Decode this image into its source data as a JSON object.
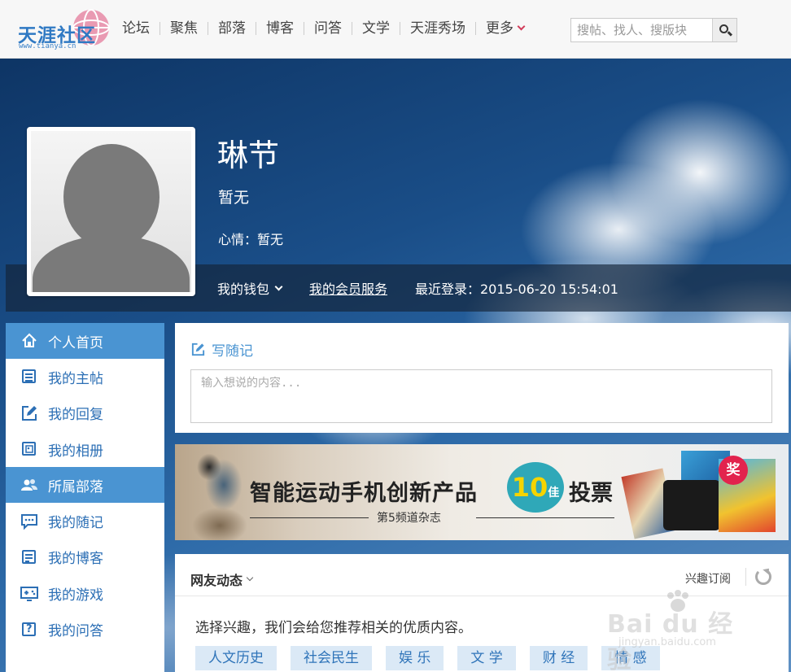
{
  "site": {
    "logo_text": "天涯社区",
    "logo_url": "www.tianya.cn"
  },
  "nav": {
    "items": [
      "论坛",
      "聚焦",
      "部落",
      "博客",
      "问答",
      "文学",
      "天涯秀场"
    ],
    "more_label": "更多",
    "search_placeholder": "搜帖、找人、搜版块"
  },
  "profile": {
    "name": "琳节",
    "signature": "暂无",
    "mood": "心情：暂无",
    "wallet_label": "我的钱包",
    "vip_label": "我的会员服务",
    "last_login": "最近登录：2015-06-20 15:54:01"
  },
  "sidebar": {
    "items": [
      {
        "label": "个人首页",
        "icon": "home-icon",
        "active": true
      },
      {
        "label": "我的主帖",
        "icon": "document-icon",
        "active": false
      },
      {
        "label": "我的回复",
        "icon": "edit-icon",
        "active": false
      },
      {
        "label": "我的相册",
        "icon": "photo-icon",
        "active": false
      },
      {
        "label": "所属部落",
        "icon": "group-icon",
        "active": true
      },
      {
        "label": "我的随记",
        "icon": "chat-icon",
        "active": false
      },
      {
        "label": "我的博客",
        "icon": "blog-icon",
        "active": false
      },
      {
        "label": "我的游戏",
        "icon": "game-icon",
        "active": false
      },
      {
        "label": "我的问答",
        "icon": "question-icon",
        "active": false
      }
    ]
  },
  "write": {
    "title": "写随记",
    "placeholder": "输入想说的内容..."
  },
  "banner": {
    "title": "智能运动手机创新产品",
    "badge_num": "10",
    "badge_suffix": "佳",
    "vote": "投票",
    "subtitle": "第5频道杂志",
    "prize": "奖"
  },
  "feed": {
    "title": "网友动态",
    "subscribe_label": "兴趣订阅",
    "prompt": "选择兴趣，我们会给您推荐相关的优质内容。",
    "tags": [
      "人文历史",
      "社会民生",
      "娱 乐",
      "文 学",
      "财 经",
      "情 感"
    ]
  },
  "watermark": {
    "text": "Bai du 经验",
    "url": "jingyan.baidu.com"
  },
  "colors": {
    "accent": "#4a94d2",
    "link": "#2c6fb5",
    "tag_bg": "#dbe9f6",
    "topbar_bg": "#f7f7f7"
  }
}
